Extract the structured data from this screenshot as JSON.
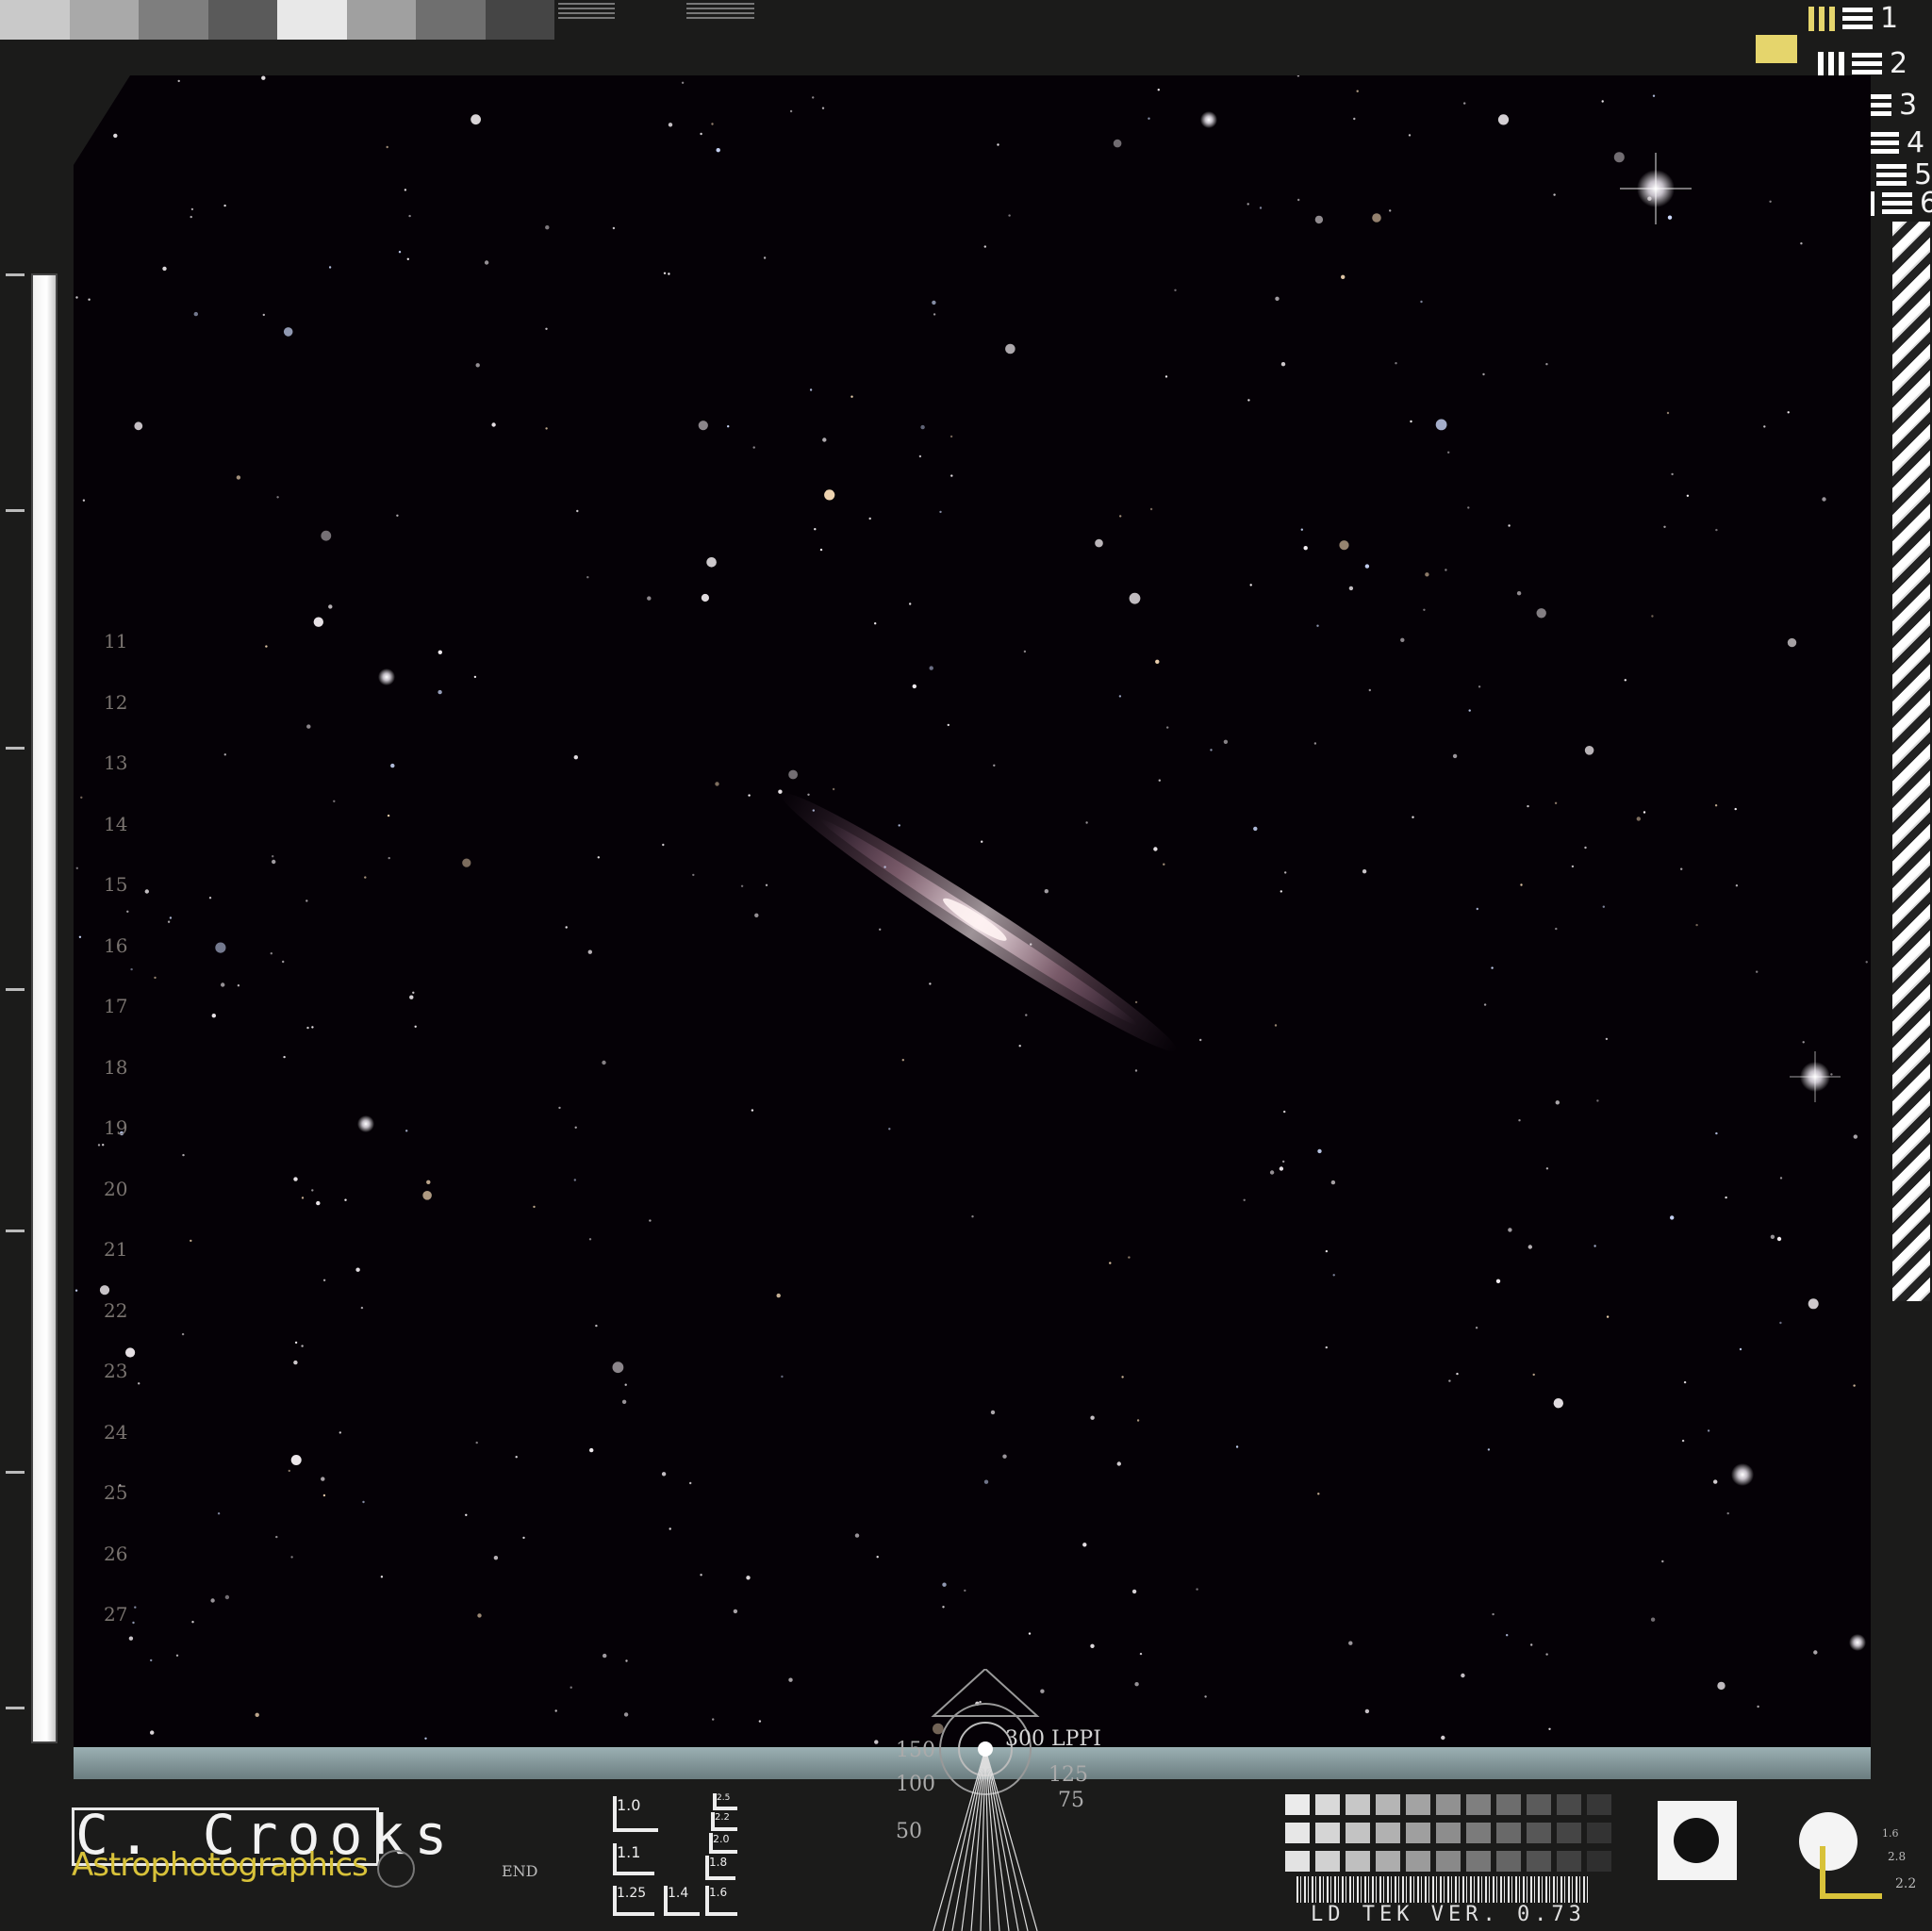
{
  "logo": {
    "name": "C. Crooks",
    "subtitle": "Astrophotographics"
  },
  "resolution_markers": [
    "1",
    "2",
    "3",
    "4",
    "5",
    "6"
  ],
  "ruler_numbers": [
    "11",
    "12",
    "13",
    "14",
    "15",
    "16",
    "17",
    "18",
    "19",
    "20",
    "21",
    "22",
    "23",
    "24",
    "25",
    "26",
    "27"
  ],
  "lppi": {
    "label": "300 LPPI",
    "left": [
      "150",
      "100",
      "50"
    ],
    "right": [
      "125",
      "75"
    ]
  },
  "resolution_blocks": [
    "1.0",
    "1.1",
    "1.25",
    "1.4",
    "1.6",
    "1.8",
    "2.0",
    "2.2",
    "2.5"
  ],
  "end_label": "END",
  "density_values": [
    "1.6",
    "2.8",
    "2.2"
  ],
  "version": "LD TEK VER. 0.73",
  "colors": {
    "frame": "#1b1b1a",
    "sky": "#050106",
    "accent_yellow": "#e5d56c",
    "logo_sub": "#d8c23a",
    "strip": "#8ea2a5"
  }
}
